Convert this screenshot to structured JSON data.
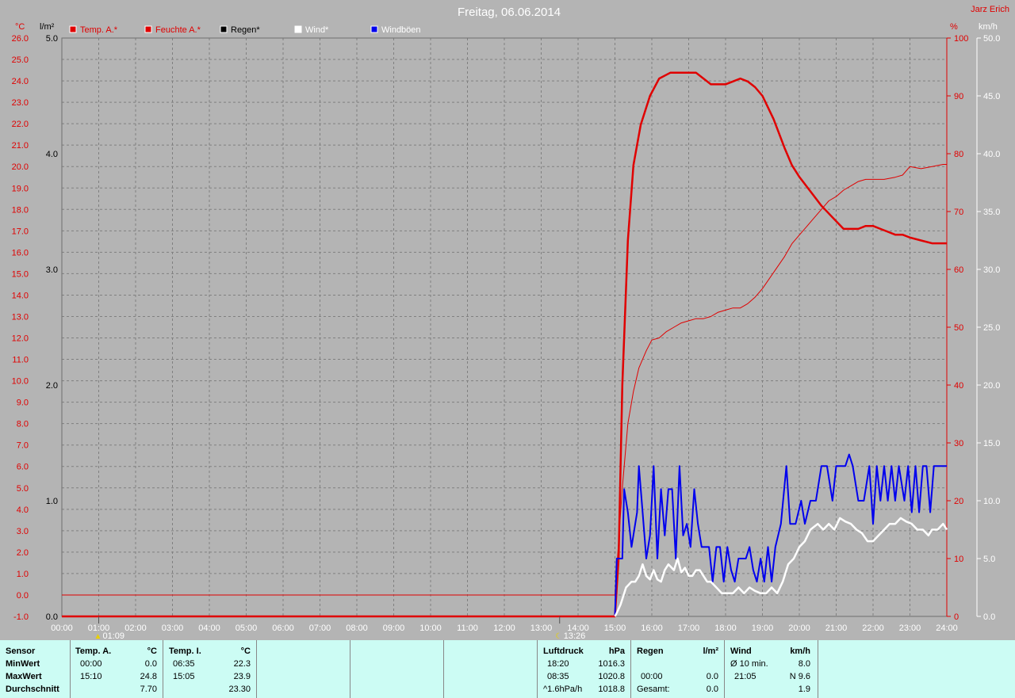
{
  "chart_data": {
    "type": "line",
    "title": "Freitag, 06.06.2014",
    "author": "Jarz Erich",
    "x_ticks": [
      "00:00",
      "01:00",
      "02:00",
      "03:00",
      "04:00",
      "05:00",
      "06:00",
      "07:00",
      "08:00",
      "09:00",
      "10:00",
      "11:00",
      "12:00",
      "13:00",
      "14:00",
      "15:00",
      "16:00",
      "17:00",
      "18:00",
      "19:00",
      "20:00",
      "21:00",
      "22:00",
      "23:00",
      "24:00"
    ],
    "axes": {
      "temp": {
        "unit": "°C",
        "min": -1.0,
        "max": 26.0,
        "ticks": [
          "26.0",
          "25.0",
          "24.0",
          "23.0",
          "22.0",
          "21.0",
          "20.0",
          "19.0",
          "18.0",
          "17.0",
          "16.0",
          "15.0",
          "14.0",
          "13.0",
          "12.0",
          "11.0",
          "10.0",
          "9.0",
          "8.0",
          "7.0",
          "6.0",
          "5.0",
          "4.0",
          "3.0",
          "2.0",
          "1.0",
          "0.0",
          "-1.0"
        ],
        "color": "#e00000"
      },
      "rain": {
        "unit": "l/m²",
        "min": 0.0,
        "max": 5.0,
        "ticks": [
          "5.0",
          "4.0",
          "3.0",
          "2.0",
          "1.0",
          "0.0"
        ],
        "color": "#000000"
      },
      "humidity": {
        "unit": "%",
        "min": 0,
        "max": 100,
        "ticks": [
          "100",
          "90",
          "80",
          "70",
          "60",
          "50",
          "40",
          "30",
          "20",
          "10",
          "0"
        ],
        "color": "#e00000"
      },
      "wind": {
        "unit": "km/h",
        "min": 0.0,
        "max": 50.0,
        "ticks": [
          "50.0",
          "45.0",
          "40.0",
          "35.0",
          "30.0",
          "25.0",
          "20.0",
          "15.0",
          "10.0",
          "5.0",
          "0.0"
        ],
        "color": "#ffffff"
      }
    },
    "legend": [
      {
        "name": "Temp. A.*",
        "color": "#e00000",
        "text_color": "#e00000"
      },
      {
        "name": "Feuchte A.*",
        "color": "#e00000",
        "text_color": "#e00000"
      },
      {
        "name": "Regen*",
        "color": "#000000",
        "text_color": "#000000"
      },
      {
        "name": "Wind*",
        "color": "#ffffff",
        "text_color": "#ffffff"
      },
      {
        "name": "Windböen",
        "color": "#0000ee",
        "text_color": "#ffffff"
      }
    ],
    "markers": [
      {
        "x": 1.0,
        "label": "01:09",
        "icon": "sunrise-icon"
      },
      {
        "x": 13.5,
        "label": "13:26",
        "icon": "moon-icon"
      }
    ],
    "series": [
      {
        "name": "Feuchte A.*",
        "axis": "humidity",
        "color": "#e00000",
        "width": 2.5,
        "points": [
          [
            0,
            0
          ],
          [
            15.0,
            0
          ],
          [
            15.1,
            10
          ],
          [
            15.2,
            40
          ],
          [
            15.35,
            65
          ],
          [
            15.5,
            78
          ],
          [
            15.7,
            85
          ],
          [
            15.95,
            90
          ],
          [
            16.2,
            93
          ],
          [
            16.5,
            94
          ],
          [
            16.8,
            94
          ],
          [
            17.0,
            94
          ],
          [
            17.2,
            94
          ],
          [
            17.4,
            93
          ],
          [
            17.6,
            92
          ],
          [
            17.8,
            92
          ],
          [
            18.0,
            92
          ],
          [
            18.2,
            92.5
          ],
          [
            18.4,
            93
          ],
          [
            18.6,
            92.5
          ],
          [
            18.8,
            91.5
          ],
          [
            19.0,
            90
          ],
          [
            19.3,
            86
          ],
          [
            19.6,
            81
          ],
          [
            19.8,
            78
          ],
          [
            20.0,
            76
          ],
          [
            20.3,
            73.5
          ],
          [
            20.6,
            71
          ],
          [
            20.9,
            69
          ],
          [
            21.2,
            67
          ],
          [
            21.4,
            67
          ],
          [
            21.6,
            67
          ],
          [
            21.8,
            67.5
          ],
          [
            22.0,
            67.5
          ],
          [
            22.2,
            67
          ],
          [
            22.4,
            66.5
          ],
          [
            22.6,
            66
          ],
          [
            22.8,
            66
          ],
          [
            23.0,
            65.5
          ],
          [
            23.3,
            65
          ],
          [
            23.6,
            64.5
          ],
          [
            23.9,
            64.5
          ],
          [
            24.0,
            64.5
          ]
        ]
      },
      {
        "name": "Temp. A.*",
        "axis": "temp",
        "color": "#e00000",
        "width": 1,
        "points": [
          [
            0,
            0
          ],
          [
            15.0,
            0
          ],
          [
            15.08,
            2
          ],
          [
            15.2,
            5
          ],
          [
            15.35,
            8
          ],
          [
            15.5,
            9.5
          ],
          [
            15.65,
            10.6
          ],
          [
            15.85,
            11.4
          ],
          [
            16.0,
            11.9
          ],
          [
            16.2,
            12.0
          ],
          [
            16.4,
            12.3
          ],
          [
            16.6,
            12.5
          ],
          [
            16.8,
            12.7
          ],
          [
            17.0,
            12.8
          ],
          [
            17.2,
            12.9
          ],
          [
            17.4,
            12.9
          ],
          [
            17.6,
            13.0
          ],
          [
            17.8,
            13.2
          ],
          [
            18.0,
            13.3
          ],
          [
            18.2,
            13.4
          ],
          [
            18.4,
            13.4
          ],
          [
            18.6,
            13.6
          ],
          [
            18.8,
            13.9
          ],
          [
            19.0,
            14.3
          ],
          [
            19.2,
            14.8
          ],
          [
            19.4,
            15.3
          ],
          [
            19.6,
            15.8
          ],
          [
            19.8,
            16.4
          ],
          [
            20.0,
            16.8
          ],
          [
            20.2,
            17.2
          ],
          [
            20.4,
            17.6
          ],
          [
            20.6,
            18.0
          ],
          [
            20.8,
            18.4
          ],
          [
            21.0,
            18.6
          ],
          [
            21.2,
            18.9
          ],
          [
            21.4,
            19.1
          ],
          [
            21.6,
            19.3
          ],
          [
            21.8,
            19.4
          ],
          [
            22.0,
            19.4
          ],
          [
            22.3,
            19.4
          ],
          [
            22.6,
            19.5
          ],
          [
            22.8,
            19.6
          ],
          [
            23.0,
            20.0
          ],
          [
            23.3,
            19.9
          ],
          [
            23.6,
            20.0
          ],
          [
            23.9,
            20.1
          ],
          [
            24.0,
            20.1
          ]
        ]
      },
      {
        "name": "Windböen",
        "axis": "wind",
        "color": "#0000ee",
        "width": 2,
        "points": [
          [
            15.0,
            0
          ],
          [
            15.05,
            5
          ],
          [
            15.2,
            5
          ],
          [
            15.25,
            11
          ],
          [
            15.35,
            9
          ],
          [
            15.45,
            6
          ],
          [
            15.6,
            9
          ],
          [
            15.65,
            13
          ],
          [
            15.75,
            9
          ],
          [
            15.85,
            5
          ],
          [
            15.95,
            7
          ],
          [
            16.05,
            13
          ],
          [
            16.15,
            5
          ],
          [
            16.25,
            11
          ],
          [
            16.35,
            7
          ],
          [
            16.45,
            11
          ],
          [
            16.55,
            11
          ],
          [
            16.65,
            5
          ],
          [
            16.75,
            13
          ],
          [
            16.85,
            7
          ],
          [
            16.95,
            8
          ],
          [
            17.05,
            6
          ],
          [
            17.15,
            11
          ],
          [
            17.25,
            8
          ],
          [
            17.35,
            6
          ],
          [
            17.45,
            6
          ],
          [
            17.55,
            6
          ],
          [
            17.65,
            3
          ],
          [
            17.75,
            6
          ],
          [
            17.85,
            6
          ],
          [
            17.95,
            3
          ],
          [
            18.05,
            6
          ],
          [
            18.15,
            4
          ],
          [
            18.25,
            3
          ],
          [
            18.35,
            5
          ],
          [
            18.55,
            5
          ],
          [
            18.65,
            6
          ],
          [
            18.75,
            4
          ],
          [
            18.85,
            3
          ],
          [
            18.95,
            5
          ],
          [
            19.05,
            3
          ],
          [
            19.15,
            6
          ],
          [
            19.25,
            3
          ],
          [
            19.35,
            6
          ],
          [
            19.5,
            8
          ],
          [
            19.65,
            13
          ],
          [
            19.75,
            8
          ],
          [
            19.9,
            8
          ],
          [
            20.05,
            10
          ],
          [
            20.15,
            8
          ],
          [
            20.3,
            10
          ],
          [
            20.45,
            10
          ],
          [
            20.6,
            13
          ],
          [
            20.75,
            13
          ],
          [
            20.9,
            10
          ],
          [
            21.0,
            13
          ],
          [
            21.15,
            13
          ],
          [
            21.25,
            13
          ],
          [
            21.35,
            14
          ],
          [
            21.45,
            13
          ],
          [
            21.6,
            10
          ],
          [
            21.75,
            10
          ],
          [
            21.9,
            13
          ],
          [
            22.0,
            8
          ],
          [
            22.1,
            13
          ],
          [
            22.2,
            10
          ],
          [
            22.3,
            13
          ],
          [
            22.4,
            10
          ],
          [
            22.5,
            13
          ],
          [
            22.6,
            10
          ],
          [
            22.7,
            13
          ],
          [
            22.85,
            10
          ],
          [
            22.95,
            13
          ],
          [
            23.05,
            9
          ],
          [
            23.15,
            13
          ],
          [
            23.25,
            9
          ],
          [
            23.35,
            13
          ],
          [
            23.45,
            13
          ],
          [
            23.55,
            9
          ],
          [
            23.65,
            13
          ],
          [
            23.75,
            13
          ],
          [
            23.9,
            13
          ],
          [
            24.0,
            13
          ]
        ]
      },
      {
        "name": "Wind*",
        "axis": "wind",
        "color": "#ffffff",
        "width": 2.5,
        "points": [
          [
            15.0,
            0
          ],
          [
            15.05,
            0.3
          ],
          [
            15.15,
            1.0
          ],
          [
            15.3,
            2.5
          ],
          [
            15.45,
            3.0
          ],
          [
            15.55,
            3.0
          ],
          [
            15.65,
            3.5
          ],
          [
            15.75,
            4.5
          ],
          [
            15.85,
            3.5
          ],
          [
            15.95,
            3.2
          ],
          [
            16.05,
            4.0
          ],
          [
            16.15,
            3.2
          ],
          [
            16.25,
            3.0
          ],
          [
            16.35,
            4.0
          ],
          [
            16.45,
            4.5
          ],
          [
            16.6,
            4.0
          ],
          [
            16.7,
            5.0
          ],
          [
            16.8,
            3.8
          ],
          [
            16.9,
            4.2
          ],
          [
            17.0,
            3.5
          ],
          [
            17.1,
            3.5
          ],
          [
            17.2,
            4.0
          ],
          [
            17.3,
            4.0
          ],
          [
            17.4,
            3.5
          ],
          [
            17.5,
            3.0
          ],
          [
            17.6,
            3.0
          ],
          [
            17.75,
            2.5
          ],
          [
            17.9,
            2.0
          ],
          [
            18.05,
            2.0
          ],
          [
            18.2,
            2.0
          ],
          [
            18.35,
            2.5
          ],
          [
            18.5,
            2.0
          ],
          [
            18.65,
            2.5
          ],
          [
            18.8,
            2.2
          ],
          [
            18.95,
            2.0
          ],
          [
            19.1,
            2.0
          ],
          [
            19.25,
            2.5
          ],
          [
            19.4,
            2.0
          ],
          [
            19.55,
            3.0
          ],
          [
            19.7,
            4.5
          ],
          [
            19.85,
            5.0
          ],
          [
            20.0,
            6.0
          ],
          [
            20.15,
            6.5
          ],
          [
            20.3,
            7.5
          ],
          [
            20.5,
            8.0
          ],
          [
            20.65,
            7.5
          ],
          [
            20.8,
            8.0
          ],
          [
            20.95,
            7.5
          ],
          [
            21.1,
            8.5
          ],
          [
            21.25,
            8.2
          ],
          [
            21.4,
            8.0
          ],
          [
            21.55,
            7.5
          ],
          [
            21.7,
            7.2
          ],
          [
            21.85,
            6.5
          ],
          [
            22.0,
            6.5
          ],
          [
            22.15,
            7.0
          ],
          [
            22.3,
            7.5
          ],
          [
            22.45,
            8.0
          ],
          [
            22.6,
            8.0
          ],
          [
            22.75,
            8.5
          ],
          [
            22.9,
            8.2
          ],
          [
            23.05,
            8.0
          ],
          [
            23.2,
            7.5
          ],
          [
            23.35,
            7.5
          ],
          [
            23.5,
            7.0
          ],
          [
            23.6,
            7.5
          ],
          [
            23.75,
            7.5
          ],
          [
            23.9,
            8.0
          ],
          [
            24.0,
            7.5
          ]
        ]
      }
    ]
  },
  "table": {
    "sensor": {
      "header": "Sensor",
      "rows": [
        "MinWert",
        "MaxWert",
        "Durchschnitt"
      ]
    },
    "temp_a": {
      "header": "Temp. A.",
      "unit": "°C",
      "times": [
        "00:00",
        "15:10",
        ""
      ],
      "values": [
        "0.0",
        "24.8",
        "7.70"
      ]
    },
    "temp_i": {
      "header": "Temp. I.",
      "unit": "°C",
      "times": [
        "06:35",
        "15:05",
        ""
      ],
      "values": [
        "22.3",
        "23.9",
        "23.30"
      ]
    },
    "luftdruck": {
      "header": "Luftdruck",
      "unit": "hPa",
      "times": [
        "18:20",
        "08:35",
        "^1.6hPa/h"
      ],
      "values": [
        "1016.3",
        "1020.8",
        "1018.8"
      ]
    },
    "regen": {
      "header": "Regen",
      "unit": "l/m²",
      "times": [
        "",
        "00:00",
        "Gesamt:"
      ],
      "values": [
        "",
        "0.0",
        "0.0"
      ]
    },
    "wind": {
      "header": "Wind",
      "unit": "km/h",
      "times": [
        "Ø 10 min.",
        "21:05",
        ""
      ],
      "values": [
        "8.0",
        "N 9.6",
        "1.9"
      ]
    }
  }
}
